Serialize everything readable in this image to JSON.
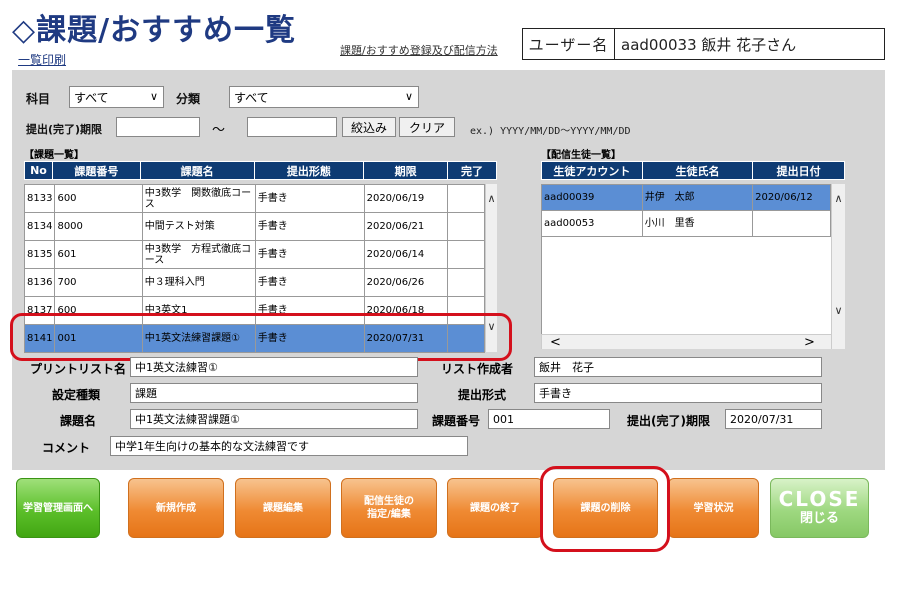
{
  "header": {
    "title": "◇課題/おすすめ一覧",
    "print_link": "一覧印刷",
    "register_link": "課題/おすすめ登録及び配信方法",
    "user_label": "ユーザー名",
    "user_value": "aad00033  飯井  花子さん"
  },
  "filters": {
    "subject_label": "科目",
    "subject_value": "すべて",
    "category_label": "分類",
    "category_value": "すべて",
    "deadline_label": "提出(完了)期限",
    "range_sep": "〜",
    "filter_button": "絞込み",
    "clear_button": "クリア",
    "format_hint": "ex.) YYYY/MM/DD〜YYYY/MM/DD"
  },
  "assignments": {
    "section_title": "【課題一覧】",
    "columns": [
      "No",
      "課題番号",
      "課題名",
      "提出形態",
      "期限",
      "完了"
    ],
    "rows": [
      {
        "no": "8133",
        "code": "600",
        "name": "中3数学　関数徹底コース",
        "type": "手書き",
        "deadline": "2020/06/19",
        "done": ""
      },
      {
        "no": "8134",
        "code": "8000",
        "name": "中間テスト対策",
        "type": "手書き",
        "deadline": "2020/06/21",
        "done": ""
      },
      {
        "no": "8135",
        "code": "601",
        "name": "中3数学　方程式徹底コース",
        "type": "手書き",
        "deadline": "2020/06/14",
        "done": ""
      },
      {
        "no": "8136",
        "code": "700",
        "name": "中３理科入門",
        "type": "手書き",
        "deadline": "2020/06/26",
        "done": ""
      },
      {
        "no": "8137",
        "code": "600",
        "name": "中3英文1",
        "type": "手書き",
        "deadline": "2020/06/18",
        "done": ""
      },
      {
        "no": "8141",
        "code": "001",
        "name": "中1英文法練習課題①",
        "type": "手書き",
        "deadline": "2020/07/31",
        "done": ""
      }
    ]
  },
  "students": {
    "section_title": "【配信生徒一覧】",
    "columns": [
      "生徒アカウント",
      "生徒氏名",
      "提出日付"
    ],
    "rows": [
      {
        "account": "aad00039",
        "name": "井伊　太郎",
        "date": "2020/06/12"
      },
      {
        "account": "aad00053",
        "name": "小川　里香",
        "date": ""
      }
    ]
  },
  "detail": {
    "print_list_label": "プリントリスト名",
    "print_list_value": "中1英文法練習①",
    "creator_label": "リスト作成者",
    "creator_value": "飯井　花子",
    "setting_type_label": "設定種類",
    "setting_type_value": "課題",
    "submit_format_label": "提出形式",
    "submit_format_value": "手書き",
    "task_name_label": "課題名",
    "task_name_value": "中1英文法練習課題①",
    "task_number_label": "課題番号",
    "task_number_value": "001",
    "deadline_label": "提出(完了)期限",
    "deadline_value": "2020/07/31",
    "comment_label": "コメント",
    "comment_value": "中学1年生向けの基本的な文法練習です"
  },
  "actions": {
    "learning_admin": "学習管理画面へ",
    "new": "新規作成",
    "edit": "課題編集",
    "assign_students": "配信生徒の\n指定/編集",
    "end_task": "課題の終了",
    "delete_task": "課題の削除",
    "learning_status": "学習状況",
    "close_en": "CLOSE",
    "close_jp": "閉じる"
  },
  "colors": {
    "title": "#1f3a82",
    "table_header": "#0e3b73",
    "selected_row": "#5b8ed4",
    "highlight_ring": "#d4101c",
    "orange_button": "#ef8a33",
    "green_button": "#5cbf2a"
  }
}
